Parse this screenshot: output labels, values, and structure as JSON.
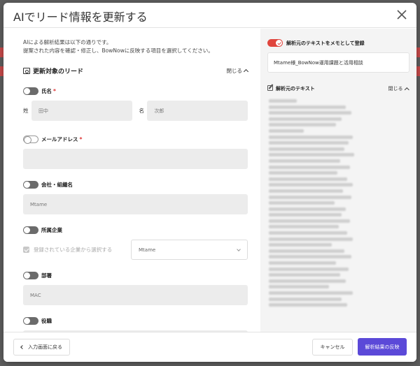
{
  "modal": {
    "title": "AIでリード情報を更新する",
    "intro_line1": "AIによる解析結果は以下の通りです。",
    "intro_line2": "提案された内容を確認・修正し、BowNowに反映する項目を選択してください。"
  },
  "lead_section": {
    "title": "更新対象のリード",
    "collapse_label": "閉じる"
  },
  "fields": {
    "name": {
      "label": "氏名",
      "required": "*",
      "last_label": "姓",
      "last_placeholder": "田中",
      "first_label": "名",
      "first_placeholder": "次郎"
    },
    "email": {
      "label": "メールアドレス",
      "required": "*",
      "value": ""
    },
    "company": {
      "label": "会社・組織名",
      "value": "Mtame"
    },
    "affiliated": {
      "label": "所属企業",
      "checkbox_label": "登録されている企業から選択する",
      "select_value": "Mtame"
    },
    "department": {
      "label": "部署",
      "value": "MAC"
    },
    "position": {
      "label": "役職",
      "value": ""
    }
  },
  "right": {
    "memo_toggle_label": "解析元のテキストをメモとして登録",
    "memo_value": "Mtame様_BowNow運用課題と活用相談",
    "source_title": "解析元のテキスト",
    "source_collapse_label": "閉じる"
  },
  "footer": {
    "back_label": "入力画面に戻る",
    "cancel_label": "キャンセル",
    "apply_label": "解析結果の反映"
  },
  "colors": {
    "accent": "#5b49d8",
    "toggle_on": "#e0453d",
    "required": "#dd3333"
  },
  "icons": {
    "close": "close-icon",
    "lead": "id-card-icon",
    "source": "edit-icon"
  }
}
